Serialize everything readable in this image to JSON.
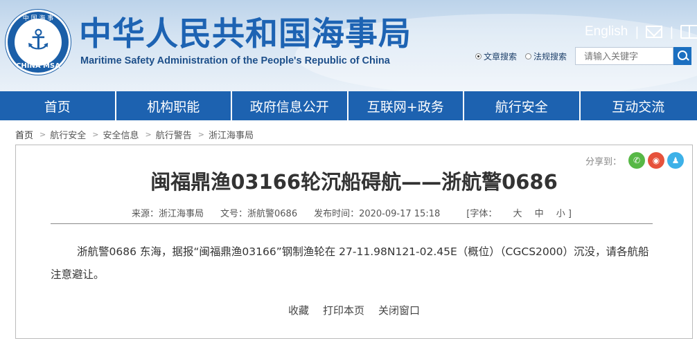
{
  "header": {
    "logo_cn": "中 国 海 事",
    "logo_en": "CHINA MSA",
    "title_cn": "中华人民共和国海事局",
    "title_en": "Maritime Safety Administration of the People's Republic of China",
    "english_link": "English",
    "separator": "|",
    "search": {
      "option_article": "文章搜索",
      "option_law": "法规搜索",
      "placeholder": "请输入关键字"
    }
  },
  "nav": {
    "items": [
      "首页",
      "机构职能",
      "政府信息公开",
      "互联网+政务",
      "航行安全",
      "互动交流"
    ]
  },
  "breadcrumb": {
    "items": [
      "首页",
      "航行安全",
      "安全信息",
      "航行警告",
      "浙江海事局"
    ],
    "arrow": ">"
  },
  "share": {
    "label": "分享到："
  },
  "article": {
    "title": "闽福鼎渔03166轮沉船碍航——浙航警0686",
    "source": "来源：浙江海事局",
    "doc_no": "文号：浙航警0686",
    "publish_time": "发布时间：2020-09-17 15:18",
    "font_label": "[字体：",
    "font_large": "大",
    "font_medium": "中",
    "font_small": "小 ]",
    "body": "浙航警0686 东海，据报“闽福鼎渔03166”钢制渔轮在 27-11.98N121-02.45E（概位）（CGCS2000）沉没，请各航船注意避让。"
  },
  "actions": {
    "favorite": "收藏",
    "print": "打印本页",
    "close": "关闭窗口"
  },
  "colors": {
    "brand_blue": "#1d62b0",
    "title_blue": "#1d63b3"
  }
}
